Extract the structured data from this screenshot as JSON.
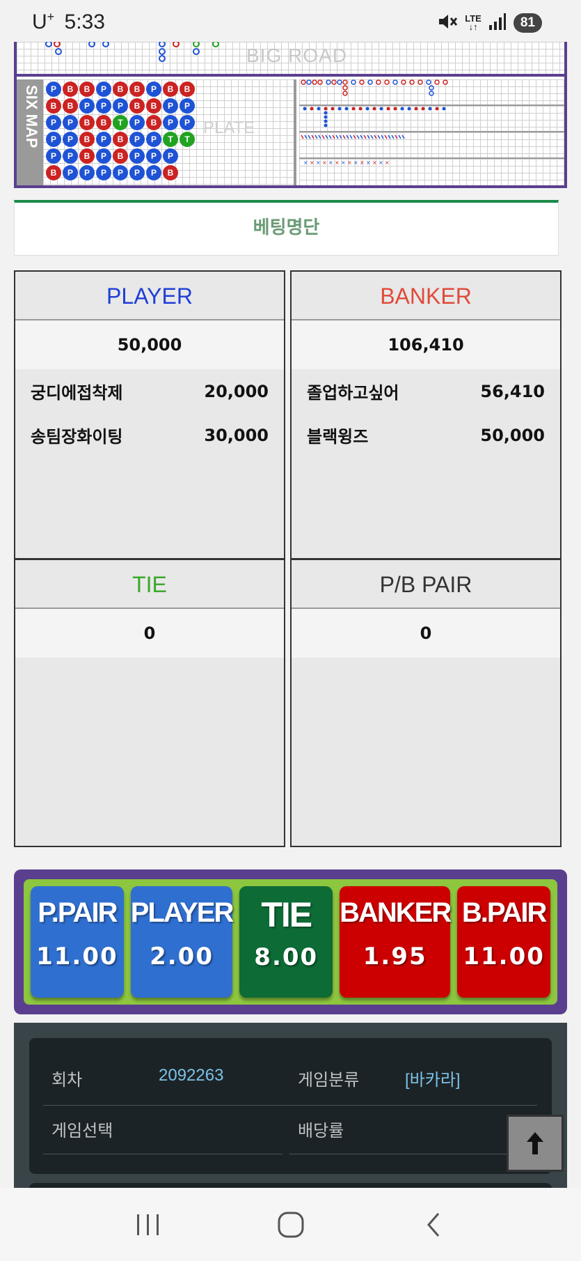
{
  "status_bar": {
    "carrier": "U",
    "carrier_sup": "+",
    "time": "5:33",
    "network": "LTE",
    "battery": "81"
  },
  "roadmap": {
    "big_road_label": "BIG ROAD",
    "six_map_label": "SIX MAP",
    "watermark": "PLATE",
    "bead_rows": [
      [
        "P",
        "B",
        "B",
        "P",
        "B",
        "B",
        "P",
        "B",
        "B"
      ],
      [
        "B",
        "B",
        "P",
        "P",
        "P",
        "B",
        "B",
        "P",
        "P"
      ],
      [
        "P",
        "P",
        "B",
        "B",
        "T",
        "P",
        "B",
        "P",
        "P"
      ],
      [
        "P",
        "P",
        "B",
        "P",
        "B",
        "P",
        "P",
        "T",
        "T"
      ],
      [
        "P",
        "P",
        "B",
        "P",
        "B",
        "P",
        "P",
        "P",
        ""
      ],
      [
        "B",
        "P",
        "P",
        "P",
        "P",
        "P",
        "P",
        "B",
        ""
      ]
    ]
  },
  "betting_list": {
    "title": "베팅명단"
  },
  "panels": {
    "player": {
      "title": "PLAYER",
      "color": "#1f3fd6",
      "total": "50,000",
      "bets": [
        {
          "name": "궁디에접착제",
          "amount": "20,000"
        },
        {
          "name": "송팀장화이팅",
          "amount": "30,000"
        }
      ]
    },
    "banker": {
      "title": "BANKER",
      "color": "#e04a3a",
      "total": "106,410",
      "bets": [
        {
          "name": "졸업하고싶어",
          "amount": "56,410"
        },
        {
          "name": "블랙윙즈",
          "amount": "50,000"
        }
      ]
    },
    "tie": {
      "title": "TIE",
      "color": "#3aa82a",
      "total": "0"
    },
    "pair": {
      "title": "P/B PAIR",
      "color": "#333333",
      "total": "0"
    }
  },
  "odds": [
    {
      "name": "P.PAIR",
      "value": "11.00",
      "color": "#2f6fd0"
    },
    {
      "name": "PLAYER",
      "value": "2.00",
      "color": "#2f6fd0"
    },
    {
      "name": "TIE",
      "value": "8.00",
      "color": "#0d6b35"
    },
    {
      "name": "BANKER",
      "value": "1.95",
      "color": "#cc0000"
    },
    {
      "name": "B.PAIR",
      "value": "11.00",
      "color": "#cc0000"
    }
  ],
  "info": {
    "round_label": "회차",
    "round_value": "2092263",
    "category_label": "게임분류",
    "category_value": "[바카라]",
    "selection_label": "게임선택",
    "selection_value": "",
    "payout_label": "배당률",
    "payout_value": ""
  }
}
